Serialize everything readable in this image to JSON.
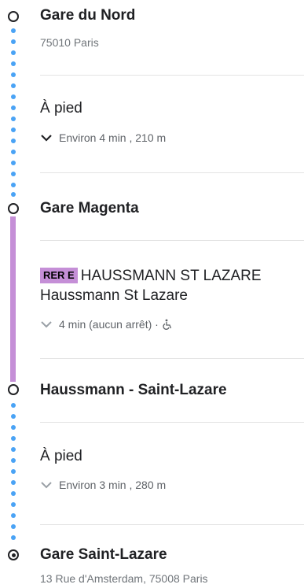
{
  "stops": [
    {
      "name": "Gare du Nord",
      "address": "75010 Paris"
    },
    {
      "name": "Gare Magenta"
    },
    {
      "name": "Haussmann - Saint-Lazare"
    },
    {
      "name": "Gare Saint-Lazare",
      "address": "13 Rue d'Amsterdam, 75008 Paris"
    }
  ],
  "legs": [
    {
      "mode": "À pied",
      "duration": "Environ 4 min , 210 m"
    },
    {
      "line_badge": "RER E",
      "line_text": "HAUSSMANN ST LAZARE Haussmann St Lazare",
      "details": "4 min (aucun arrêt) ·"
    },
    {
      "mode": "À pied",
      "duration": "Environ 3 min , 280 m"
    }
  ],
  "colors": {
    "walk_dot": "#4aa3f5",
    "rer_e": "#c58fd7",
    "text": "#202124",
    "secondary": "#70757a"
  },
  "icons": {
    "expand": "chevron-down-icon",
    "accessibility": "wheelchair-icon"
  }
}
